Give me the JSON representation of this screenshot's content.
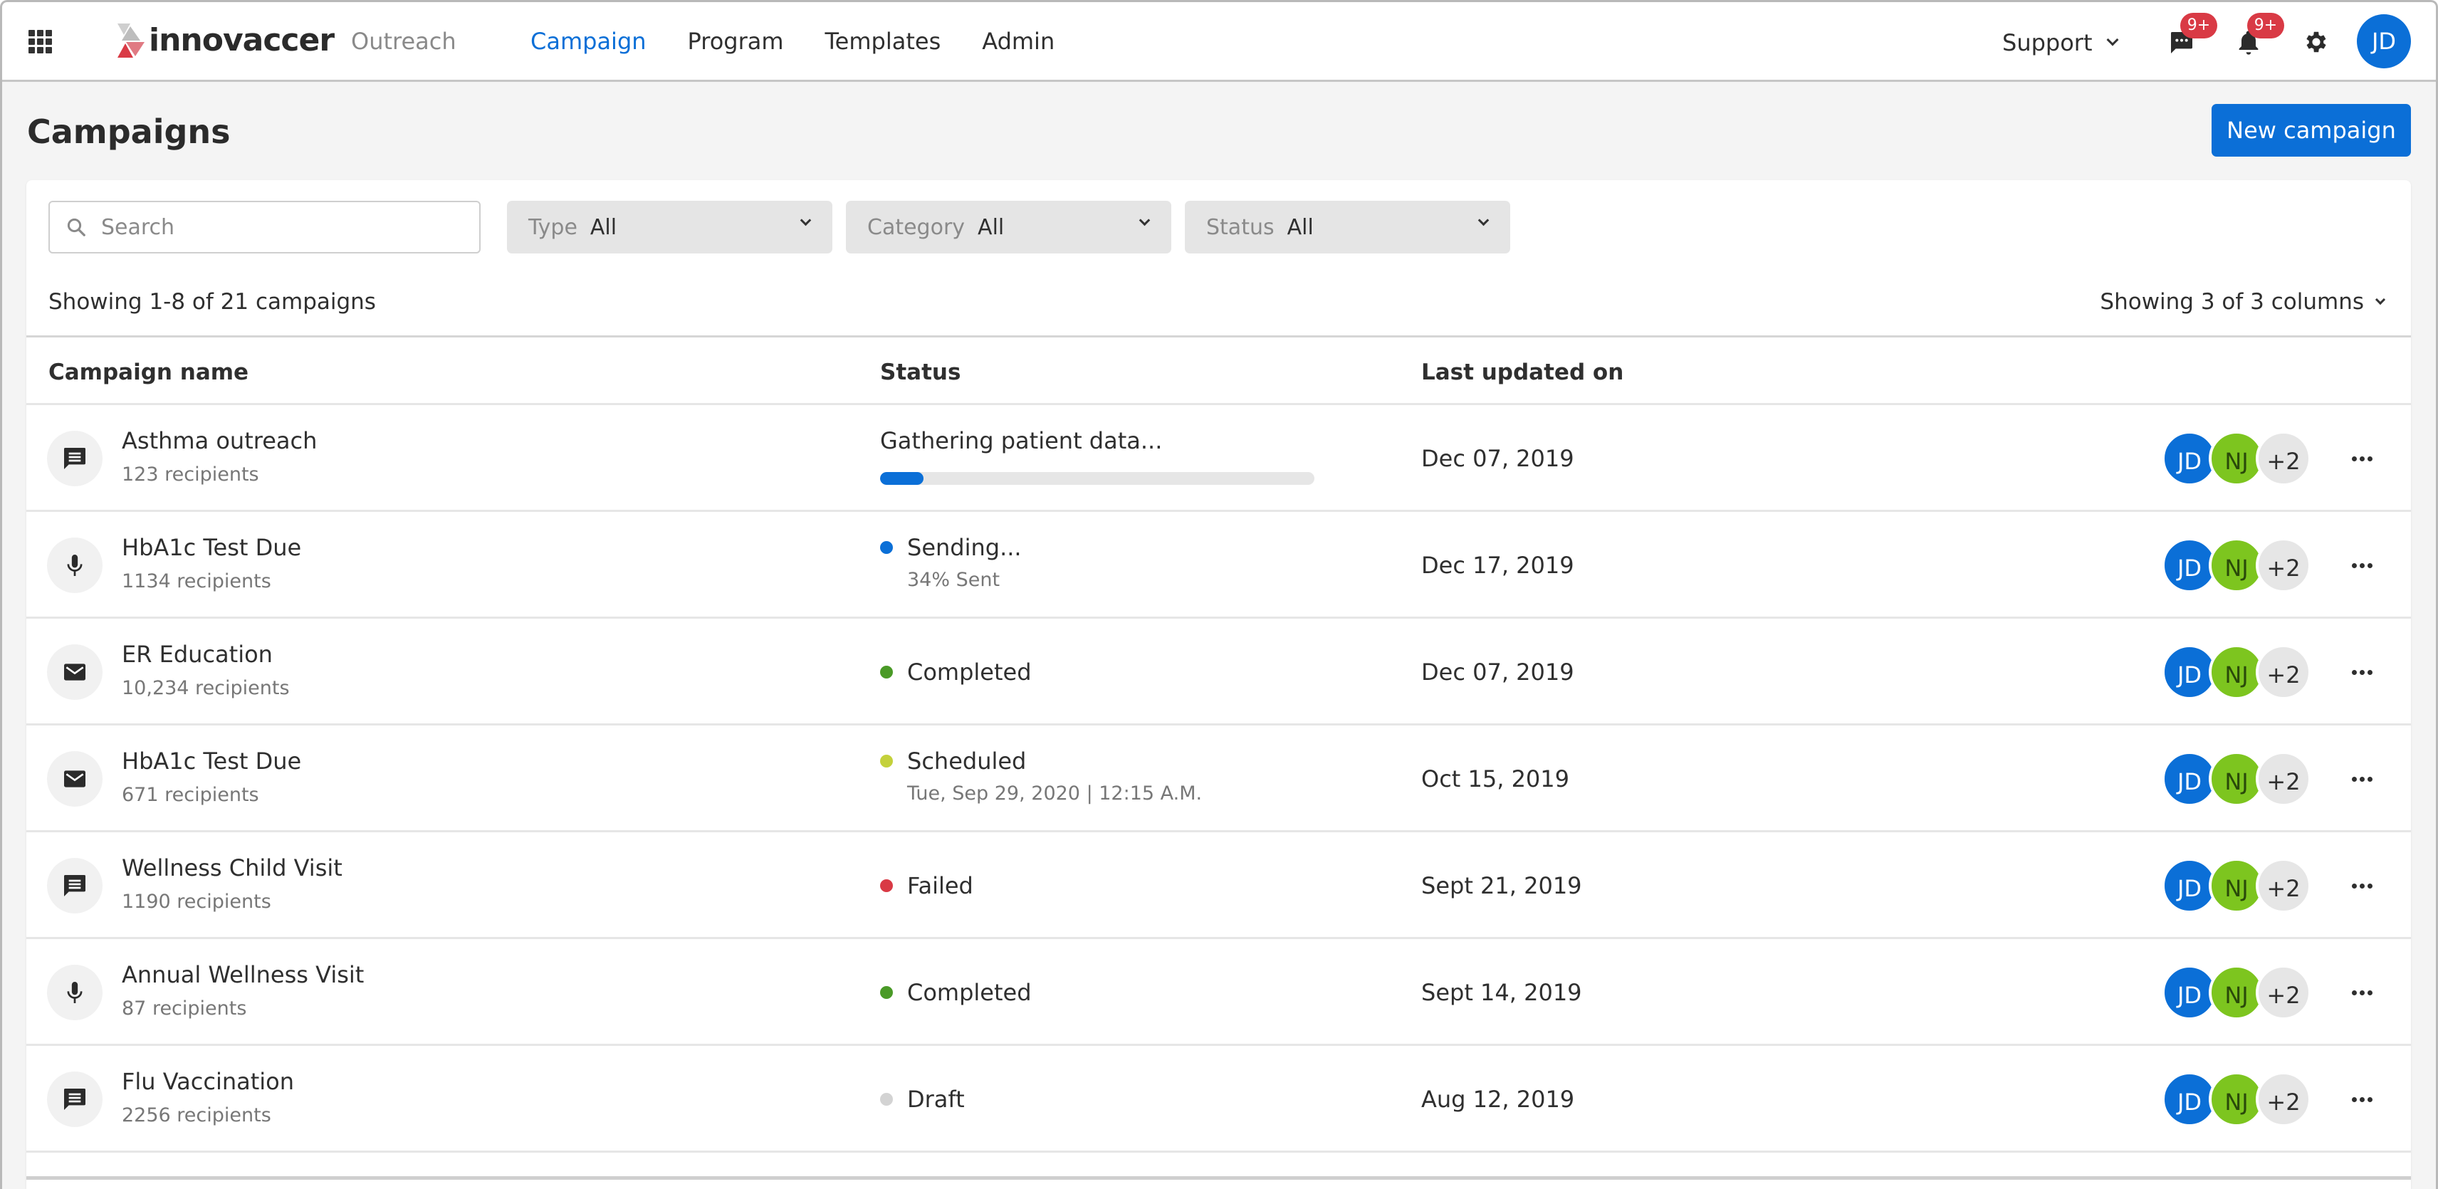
{
  "nav": {
    "brand": "innovaccer",
    "product": "Outreach",
    "links": [
      {
        "label": "Campaign",
        "active": true
      },
      {
        "label": "Program",
        "active": false
      },
      {
        "label": "Templates",
        "active": false
      },
      {
        "label": "Admin",
        "active": false
      }
    ],
    "support_label": "Support",
    "messages_badge": "9+",
    "notifications_badge": "9+",
    "user_initials": "JD"
  },
  "page": {
    "title": "Campaigns",
    "new_button_label": "New campaign"
  },
  "filters": {
    "search_placeholder": "Search",
    "search_value": "",
    "type": {
      "label": "Type",
      "value": "All"
    },
    "category": {
      "label": "Category",
      "value": "All"
    },
    "status": {
      "label": "Status",
      "value": "All"
    }
  },
  "summary": {
    "showing_text": "Showing 1-8 of 21 campaigns",
    "columns_text": "Showing 3 of 3 columns"
  },
  "table": {
    "columns": [
      "Campaign name",
      "Status",
      "Last updated on"
    ],
    "rows": [
      {
        "channel": "chat-icon",
        "name": "Asthma outreach",
        "recipients": "123 recipients",
        "status": "Gathering patient data...",
        "status_kind": "progress",
        "progress": 0.1,
        "sub": "",
        "dot_color": "",
        "date": "Dec 07, 2019",
        "avatars": [
          "JD",
          "NJ"
        ],
        "more_count": "+2"
      },
      {
        "channel": "mic-icon",
        "name": "HbA1c Test Due",
        "recipients": "1134 recipients",
        "status": "Sending...",
        "status_kind": "dot",
        "sub": "34% Sent",
        "dot_color": "#0b6fd7",
        "date": "Dec 17, 2019",
        "avatars": [
          "JD",
          "NJ"
        ],
        "more_count": "+2"
      },
      {
        "channel": "mail-icon",
        "name": "ER Education",
        "recipients": "10,234 recipients",
        "status": "Completed",
        "status_kind": "dot",
        "sub": "",
        "dot_color": "#4a9a27",
        "date": "Dec 07, 2019",
        "avatars": [
          "JD",
          "NJ"
        ],
        "more_count": "+2"
      },
      {
        "channel": "mail-icon",
        "name": "HbA1c Test Due",
        "recipients": "671 recipients",
        "status": "Scheduled",
        "status_kind": "dot",
        "sub": "Tue, Sep 29, 2020 | 12:15 A.M.",
        "dot_color": "#c4d13b",
        "date": "Oct 15, 2019",
        "avatars": [
          "JD",
          "NJ"
        ],
        "more_count": "+2"
      },
      {
        "channel": "chat-icon",
        "name": "Wellness Child Visit",
        "recipients": "1190 recipients",
        "status": "Failed",
        "status_kind": "dot",
        "sub": "",
        "dot_color": "#d93a45",
        "date": "Sept 21, 2019",
        "avatars": [
          "JD",
          "NJ"
        ],
        "more_count": "+2"
      },
      {
        "channel": "mic-icon",
        "name": "Annual Wellness Visit",
        "recipients": "87 recipients",
        "status": "Completed",
        "status_kind": "dot",
        "sub": "",
        "dot_color": "#4a9a27",
        "date": "Sept 14, 2019",
        "avatars": [
          "JD",
          "NJ"
        ],
        "more_count": "+2"
      },
      {
        "channel": "chat-icon",
        "name": "Flu Vaccination",
        "recipients": "2256 recipients",
        "status": "Draft",
        "status_kind": "dot",
        "sub": "",
        "dot_color": "#d3d3d3",
        "date": "Aug 12, 2019",
        "avatars": [
          "JD",
          "NJ"
        ],
        "more_count": "+2"
      }
    ]
  },
  "colors": {
    "primary": "#0b6fd7",
    "alert": "#d93a45",
    "success": "#4a9a27",
    "warning": "#c4d13b",
    "avatar_secondary": "#7dc51f"
  }
}
